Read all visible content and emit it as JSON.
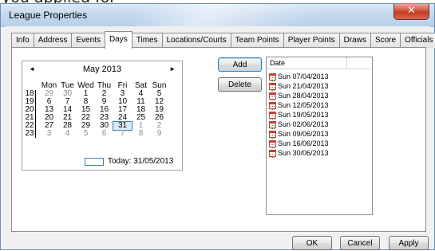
{
  "window": {
    "title": "League Properties",
    "close_glyph": "✕",
    "clipped_text": "you applied for",
    "close_icon": "close-icon"
  },
  "tabs": [
    {
      "label": "Info"
    },
    {
      "label": "Address"
    },
    {
      "label": "Events"
    },
    {
      "label": "Days",
      "active": true
    },
    {
      "label": "Times"
    },
    {
      "label": "Locations/Courts"
    },
    {
      "label": "Team Points"
    },
    {
      "label": "Player Points"
    },
    {
      "label": "Draws"
    },
    {
      "label": "Score"
    },
    {
      "label": "Officials"
    }
  ],
  "calendar": {
    "month_label": "May 2013",
    "prev_glyph": "◄",
    "next_glyph": "►",
    "dow": [
      "Mon",
      "Tue",
      "Wed",
      "Thu",
      "Fri",
      "Sat",
      "Sun"
    ],
    "week_numbers": [
      "18",
      "19",
      "20",
      "21",
      "22",
      "23"
    ],
    "rows": [
      [
        "29",
        "30",
        "1",
        "2",
        "3",
        "4",
        "5"
      ],
      [
        "6",
        "7",
        "8",
        "9",
        "10",
        "11",
        "12"
      ],
      [
        "13",
        "14",
        "15",
        "16",
        "17",
        "18",
        "19"
      ],
      [
        "20",
        "21",
        "22",
        "23",
        "24",
        "25",
        "26"
      ],
      [
        "27",
        "28",
        "29",
        "30",
        "31",
        "1",
        "2"
      ],
      [
        "3",
        "4",
        "5",
        "6",
        "7",
        "8",
        "9"
      ]
    ],
    "selected": "31",
    "today_label": "Today: 31/05/2013"
  },
  "actions": {
    "add_label": "Add",
    "delete_label": "Delete"
  },
  "date_list": {
    "header": "Date",
    "items": [
      "Sun 07/04/2013",
      "Sun 21/04/2013",
      "Sun 28/04/2013",
      "Sun 12/05/2013",
      "Sun 19/05/2013",
      "Sun 02/06/2013",
      "Sun 09/06/2013",
      "Sun 16/06/2013",
      "Sun 30/06/2013"
    ],
    "item_icon": "calendar-icon"
  },
  "footer": {
    "ok_label": "OK",
    "cancel_label": "Cancel",
    "apply_label": "Apply"
  },
  "colors": {
    "title_bar": "#c5d9ee",
    "close_button": "#c23a22",
    "selection_border": "#3c7fb1"
  }
}
